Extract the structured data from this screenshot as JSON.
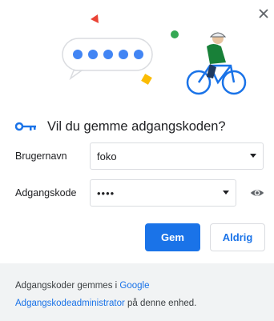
{
  "dialog": {
    "title": "Vil du gemme adgangskoden?",
    "close_icon": "close-icon",
    "key_icon": "key-icon",
    "username": {
      "label": "Brugernavn",
      "value": "foko"
    },
    "password": {
      "label": "Adgangskode",
      "value": "••••",
      "reveal_icon": "eye-icon"
    },
    "buttons": {
      "save": "Gem",
      "never": "Aldrig"
    },
    "footer": {
      "text_before": "Adgangskoder gemmes i ",
      "link_part1": "Google",
      "link_part2": "Adgangskodeadministrator",
      "text_after": " på denne enhed."
    },
    "colors": {
      "accent": "#1a73e8",
      "footer_bg": "#f1f3f4"
    }
  }
}
